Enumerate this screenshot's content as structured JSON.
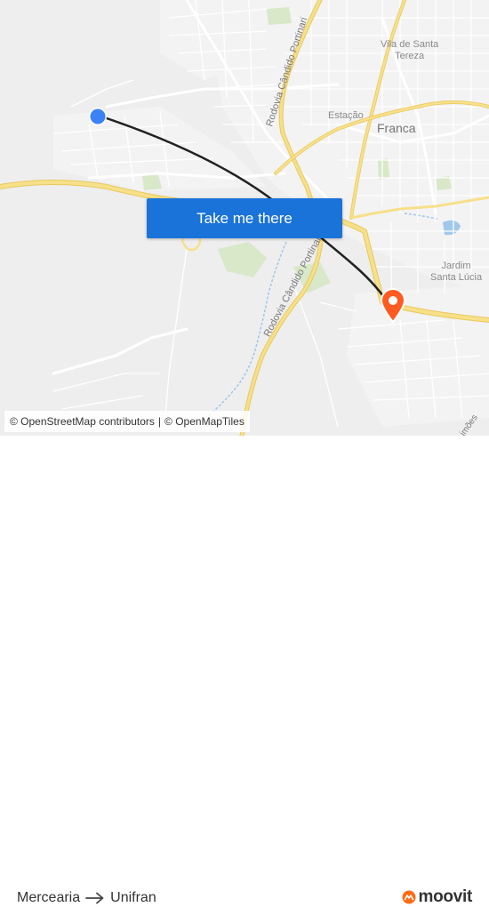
{
  "map": {
    "place_labels": {
      "vila_santa_tereza": "Vila de Santa\nTereza",
      "franca": "Franca",
      "estacao": "Estação",
      "jardim_santa_lucia": "Jardim\nSanta Lúcia"
    },
    "road_labels": {
      "rodovia_upper": "Rodovia Cândido Portinari",
      "rodovia_lower": "Rodovia Cândido Portinari",
      "edge_fragment": "imões"
    },
    "colors": {
      "background": "#eeeeee",
      "streets": "#ffffff",
      "highway": "#f6dd7a",
      "park": "#d8e8c8",
      "water": "#9fc8ea",
      "route_line": "#222222",
      "origin_marker": "#3b82f6",
      "destination_marker": "#ff5a1f"
    }
  },
  "cta": {
    "label": "Take me there"
  },
  "attribution": {
    "osm": "© OpenStreetMap contributors",
    "separator": "|",
    "omt": "© OpenMapTiles"
  },
  "footer": {
    "origin": "Mercearia",
    "destination": "Unifran",
    "brand": "moovit"
  }
}
